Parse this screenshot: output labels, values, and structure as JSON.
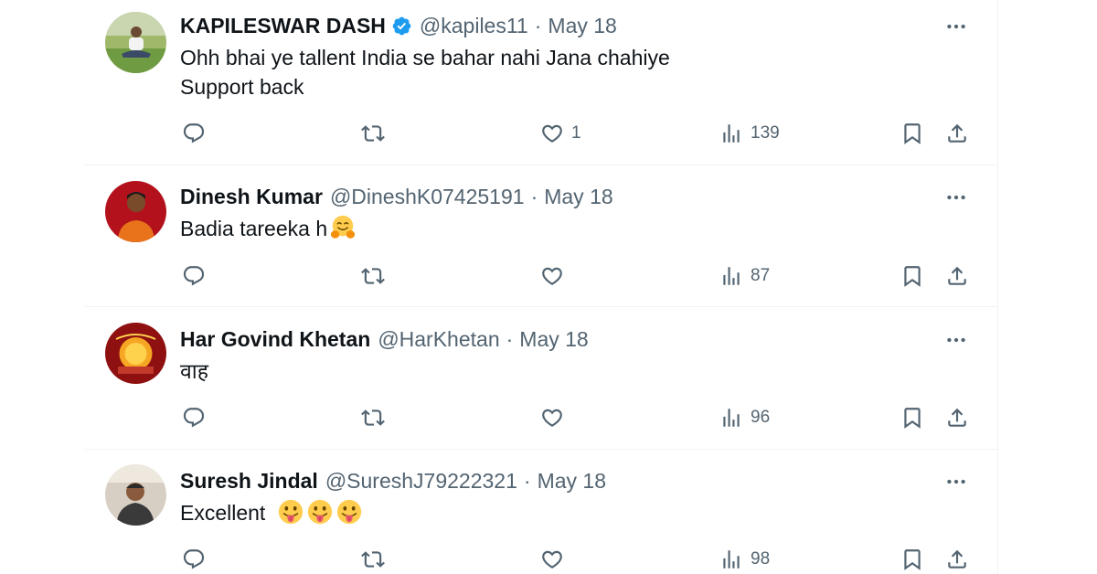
{
  "replies": [
    {
      "name": "KAPILESWAR DASH",
      "verified": true,
      "handle": "@kapiles11",
      "separator": "·",
      "date": "May 18",
      "text_lines": [
        "Ohh bhai ye tallent India se bahar nahi Jana chahiye",
        "Support back"
      ],
      "likes": "1",
      "views": "139"
    },
    {
      "name": "Dinesh Kumar",
      "verified": false,
      "handle": "@DineshK07425191",
      "separator": "·",
      "date": "May 18",
      "text": "Badia tareeka h",
      "emoji": "hugging-face",
      "views": "87"
    },
    {
      "name": "Har Govind Khetan",
      "verified": false,
      "handle": "@HarKhetan",
      "separator": "·",
      "date": "May 18",
      "text": "वाह",
      "views": "96"
    },
    {
      "name": "Suresh Jindal",
      "verified": false,
      "handle": "@SureshJ79222321",
      "separator": "·",
      "date": "May 18",
      "text": "Excellent",
      "emoji": "face-with-tongue",
      "emoji_count": 3,
      "views": "98"
    }
  ],
  "icons": {
    "reply": "reply-icon",
    "retweet": "retweet-icon",
    "like": "like-icon",
    "views": "views-icon",
    "bookmark": "bookmark-icon",
    "share": "share-icon",
    "more": "more-icon",
    "verified": "verified-badge-icon"
  },
  "colors": {
    "text": "#0f1419",
    "secondary": "#536471",
    "verified": "#1d9bf0",
    "divider": "#eff3f4"
  }
}
